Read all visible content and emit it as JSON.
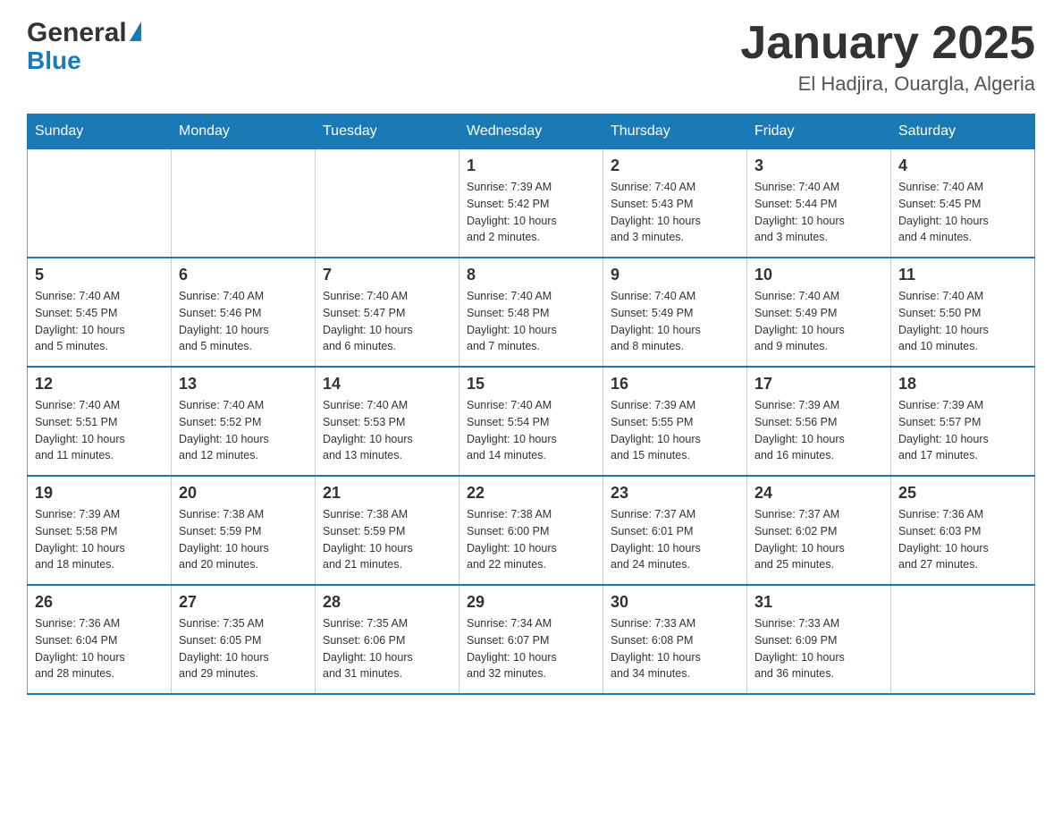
{
  "header": {
    "logo_general": "General",
    "logo_blue": "Blue",
    "month": "January 2025",
    "location": "El Hadjira, Ouargla, Algeria"
  },
  "days_of_week": [
    "Sunday",
    "Monday",
    "Tuesday",
    "Wednesday",
    "Thursday",
    "Friday",
    "Saturday"
  ],
  "weeks": [
    [
      {
        "day": "",
        "info": ""
      },
      {
        "day": "",
        "info": ""
      },
      {
        "day": "",
        "info": ""
      },
      {
        "day": "1",
        "info": "Sunrise: 7:39 AM\nSunset: 5:42 PM\nDaylight: 10 hours\nand 2 minutes."
      },
      {
        "day": "2",
        "info": "Sunrise: 7:40 AM\nSunset: 5:43 PM\nDaylight: 10 hours\nand 3 minutes."
      },
      {
        "day": "3",
        "info": "Sunrise: 7:40 AM\nSunset: 5:44 PM\nDaylight: 10 hours\nand 3 minutes."
      },
      {
        "day": "4",
        "info": "Sunrise: 7:40 AM\nSunset: 5:45 PM\nDaylight: 10 hours\nand 4 minutes."
      }
    ],
    [
      {
        "day": "5",
        "info": "Sunrise: 7:40 AM\nSunset: 5:45 PM\nDaylight: 10 hours\nand 5 minutes."
      },
      {
        "day": "6",
        "info": "Sunrise: 7:40 AM\nSunset: 5:46 PM\nDaylight: 10 hours\nand 5 minutes."
      },
      {
        "day": "7",
        "info": "Sunrise: 7:40 AM\nSunset: 5:47 PM\nDaylight: 10 hours\nand 6 minutes."
      },
      {
        "day": "8",
        "info": "Sunrise: 7:40 AM\nSunset: 5:48 PM\nDaylight: 10 hours\nand 7 minutes."
      },
      {
        "day": "9",
        "info": "Sunrise: 7:40 AM\nSunset: 5:49 PM\nDaylight: 10 hours\nand 8 minutes."
      },
      {
        "day": "10",
        "info": "Sunrise: 7:40 AM\nSunset: 5:49 PM\nDaylight: 10 hours\nand 9 minutes."
      },
      {
        "day": "11",
        "info": "Sunrise: 7:40 AM\nSunset: 5:50 PM\nDaylight: 10 hours\nand 10 minutes."
      }
    ],
    [
      {
        "day": "12",
        "info": "Sunrise: 7:40 AM\nSunset: 5:51 PM\nDaylight: 10 hours\nand 11 minutes."
      },
      {
        "day": "13",
        "info": "Sunrise: 7:40 AM\nSunset: 5:52 PM\nDaylight: 10 hours\nand 12 minutes."
      },
      {
        "day": "14",
        "info": "Sunrise: 7:40 AM\nSunset: 5:53 PM\nDaylight: 10 hours\nand 13 minutes."
      },
      {
        "day": "15",
        "info": "Sunrise: 7:40 AM\nSunset: 5:54 PM\nDaylight: 10 hours\nand 14 minutes."
      },
      {
        "day": "16",
        "info": "Sunrise: 7:39 AM\nSunset: 5:55 PM\nDaylight: 10 hours\nand 15 minutes."
      },
      {
        "day": "17",
        "info": "Sunrise: 7:39 AM\nSunset: 5:56 PM\nDaylight: 10 hours\nand 16 minutes."
      },
      {
        "day": "18",
        "info": "Sunrise: 7:39 AM\nSunset: 5:57 PM\nDaylight: 10 hours\nand 17 minutes."
      }
    ],
    [
      {
        "day": "19",
        "info": "Sunrise: 7:39 AM\nSunset: 5:58 PM\nDaylight: 10 hours\nand 18 minutes."
      },
      {
        "day": "20",
        "info": "Sunrise: 7:38 AM\nSunset: 5:59 PM\nDaylight: 10 hours\nand 20 minutes."
      },
      {
        "day": "21",
        "info": "Sunrise: 7:38 AM\nSunset: 5:59 PM\nDaylight: 10 hours\nand 21 minutes."
      },
      {
        "day": "22",
        "info": "Sunrise: 7:38 AM\nSunset: 6:00 PM\nDaylight: 10 hours\nand 22 minutes."
      },
      {
        "day": "23",
        "info": "Sunrise: 7:37 AM\nSunset: 6:01 PM\nDaylight: 10 hours\nand 24 minutes."
      },
      {
        "day": "24",
        "info": "Sunrise: 7:37 AM\nSunset: 6:02 PM\nDaylight: 10 hours\nand 25 minutes."
      },
      {
        "day": "25",
        "info": "Sunrise: 7:36 AM\nSunset: 6:03 PM\nDaylight: 10 hours\nand 27 minutes."
      }
    ],
    [
      {
        "day": "26",
        "info": "Sunrise: 7:36 AM\nSunset: 6:04 PM\nDaylight: 10 hours\nand 28 minutes."
      },
      {
        "day": "27",
        "info": "Sunrise: 7:35 AM\nSunset: 6:05 PM\nDaylight: 10 hours\nand 29 minutes."
      },
      {
        "day": "28",
        "info": "Sunrise: 7:35 AM\nSunset: 6:06 PM\nDaylight: 10 hours\nand 31 minutes."
      },
      {
        "day": "29",
        "info": "Sunrise: 7:34 AM\nSunset: 6:07 PM\nDaylight: 10 hours\nand 32 minutes."
      },
      {
        "day": "30",
        "info": "Sunrise: 7:33 AM\nSunset: 6:08 PM\nDaylight: 10 hours\nand 34 minutes."
      },
      {
        "day": "31",
        "info": "Sunrise: 7:33 AM\nSunset: 6:09 PM\nDaylight: 10 hours\nand 36 minutes."
      },
      {
        "day": "",
        "info": ""
      }
    ]
  ]
}
